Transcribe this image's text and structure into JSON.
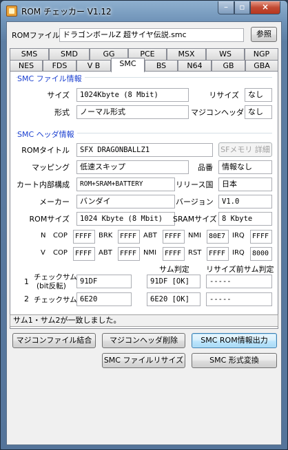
{
  "window": {
    "title": "ROM チェッカー V1.12"
  },
  "file": {
    "label": "ROMファイル",
    "value": "ドラゴンボールZ 超サイヤ伝説.smc",
    "browse_label": "参照"
  },
  "tabs_row1": [
    "SMS",
    "SMD",
    "GG",
    "PCE",
    "MSX",
    "WS",
    "NGP"
  ],
  "tabs_row2": [
    "NES",
    "FDS",
    "V B",
    "SMC",
    "BS",
    "N64",
    "GB",
    "GBA"
  ],
  "selected_tab": "SMC",
  "file_info": {
    "title": "SMC ファイル情報",
    "size_label": "サイズ",
    "size_value": "1024Kbyte (8 Mbit)",
    "resize_label": "リサイズ",
    "resize_value": "なし",
    "format_label": "形式",
    "format_value": "ノーマル形式",
    "copier_header_label": "マジコンヘッダ",
    "copier_header_value": "なし"
  },
  "header_info": {
    "title": "SMC ヘッダ情報",
    "rom_title_label": "ROMタイトル",
    "rom_title_value": "SFX DRAGONBALLZ1",
    "sfmemory_button": "SFメモリ 詳細",
    "mapping_label": "マッピング",
    "mapping_value": "低速スキップ",
    "product_label": "品番",
    "product_value": "情報なし",
    "cart_label": "カート内部構成",
    "cart_value": "ROM+SRAM+BATTERY",
    "region_label": "リリース国",
    "region_value": "日本",
    "maker_label": "メーカー",
    "maker_value": "バンダイ",
    "version_label": "バージョン",
    "version_value": "V1.0",
    "romsize_label": "ROMサイズ",
    "romsize_value": "1024 Kbyte (8 Mbit)",
    "sramsize_label": "SRAMサイズ",
    "sramsize_value": "8 Kbyte"
  },
  "vectors": {
    "n_row": {
      "label": "N",
      "items": [
        [
          "COP",
          "FFFF"
        ],
        [
          "BRK",
          "FFFF"
        ],
        [
          "ABT",
          "FFFF"
        ],
        [
          "NMI",
          "80E7"
        ],
        [
          "IRQ",
          "FFFF"
        ]
      ]
    },
    "v_row": {
      "label": "V",
      "items": [
        [
          "COP",
          "FFFF"
        ],
        [
          "ABT",
          "FFFF"
        ],
        [
          "NMI",
          "FFFF"
        ],
        [
          "RST",
          "FFFF"
        ],
        [
          "IRQ",
          "8000"
        ]
      ]
    }
  },
  "checksum": {
    "col_judge": "サム判定",
    "col_pre_resize": "リサイズ前サム判定",
    "row1_num": "1",
    "row1_label_a": "チェックサム",
    "row1_label_b": "(bit反転)",
    "row1_value": "91DF",
    "row1_judge": "91DF [OK]",
    "row1_pre": "-----",
    "row2_num": "2",
    "row2_label": "チェックサム",
    "row2_value": "6E20",
    "row2_judge": "6E20 [OK]",
    "row2_pre": "-----"
  },
  "status_text": "サム1・サム2が一致しました。",
  "buttons": {
    "combine": "マジコンファイル結合",
    "delete_header": "マジコンヘッダ削除",
    "output_info": "SMC ROM情報出力",
    "file_resize": "SMC ファイルリサイズ",
    "convert": "SMC 形式変換"
  }
}
